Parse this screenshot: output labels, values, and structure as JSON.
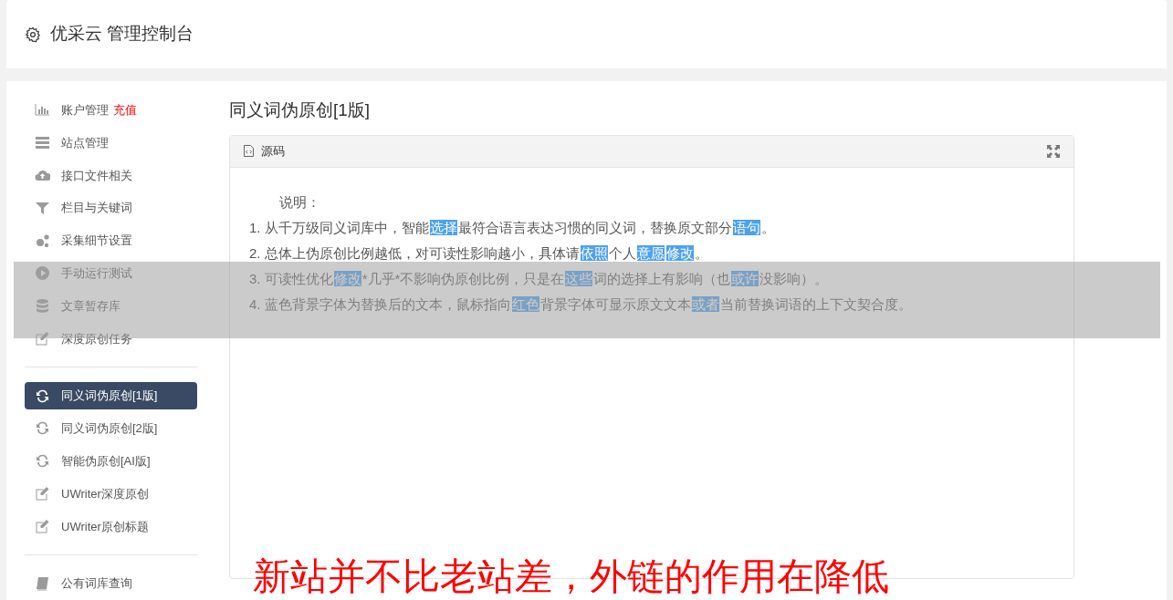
{
  "header": {
    "title": "优采云 管理控制台"
  },
  "sidebar": {
    "groups": [
      [
        {
          "label": "账户管理",
          "badge": "充值",
          "selected": false
        },
        {
          "label": "站点管理",
          "selected": false
        },
        {
          "label": "接口文件相关",
          "selected": false
        },
        {
          "label": "栏目与关键词",
          "selected": false
        },
        {
          "label": "采集细节设置",
          "selected": false
        },
        {
          "label": "手动运行测试",
          "selected": false
        },
        {
          "label": "文章暂存库",
          "selected": false
        },
        {
          "label": "深度原创任务",
          "selected": false
        }
      ],
      [
        {
          "label": "同义词伪原创[1版]",
          "selected": true
        },
        {
          "label": "同义词伪原创[2版]",
          "selected": false
        },
        {
          "label": "智能伪原创[AI版]",
          "selected": false
        },
        {
          "label": "UWriter深度原创",
          "selected": false
        },
        {
          "label": "UWriter原创标题",
          "selected": false
        }
      ],
      [
        {
          "label": "公有词库查询",
          "selected": false
        }
      ]
    ]
  },
  "content": {
    "title": "同义词伪原创[1版]",
    "panel": {
      "tab": "源码",
      "heading": "说明：",
      "lines": [
        [
          {
            "text": "1. 从千万级同义词库中，智能",
            "highlight": false
          },
          {
            "text": "选择",
            "highlight": true
          },
          {
            "text": "最符合语言表达习惯的同义词，替换原文部分",
            "highlight": false
          },
          {
            "text": "语句",
            "highlight": true
          },
          {
            "text": "。",
            "highlight": false
          }
        ],
        [
          {
            "text": "2. 总体上伪原创比例越低，对可读性影响越小，具体请",
            "highlight": false
          },
          {
            "text": "依照",
            "highlight": true
          },
          {
            "text": "个人",
            "highlight": false
          },
          {
            "text": "意愿",
            "highlight": true
          },
          {
            "text": "修改",
            "highlight": true
          },
          {
            "text": "。",
            "highlight": false
          }
        ],
        [
          {
            "text": "3. 可读性优化",
            "highlight": false
          },
          {
            "text": "修改",
            "highlight": true
          },
          {
            "text": "*几乎*不影响伪原创比例，只是在",
            "highlight": false
          },
          {
            "text": "这些",
            "highlight": true
          },
          {
            "text": "词的选择上有影响（也",
            "highlight": false
          },
          {
            "text": "或许",
            "highlight": true
          },
          {
            "text": "没影响）。",
            "highlight": false
          }
        ],
        [
          {
            "text": "4. 蓝色背景字体为替换后的文本，鼠标指向",
            "highlight": false
          },
          {
            "text": "红色",
            "highlight": true
          },
          {
            "text": "背景字体可显示原文文本",
            "highlight": false
          },
          {
            "text": "或者",
            "highlight": true
          },
          {
            "text": "当前替换词语的上下文契合度。",
            "highlight": false
          }
        ]
      ]
    }
  },
  "caption": "新站并不比老站差，外链的作用在降低"
}
